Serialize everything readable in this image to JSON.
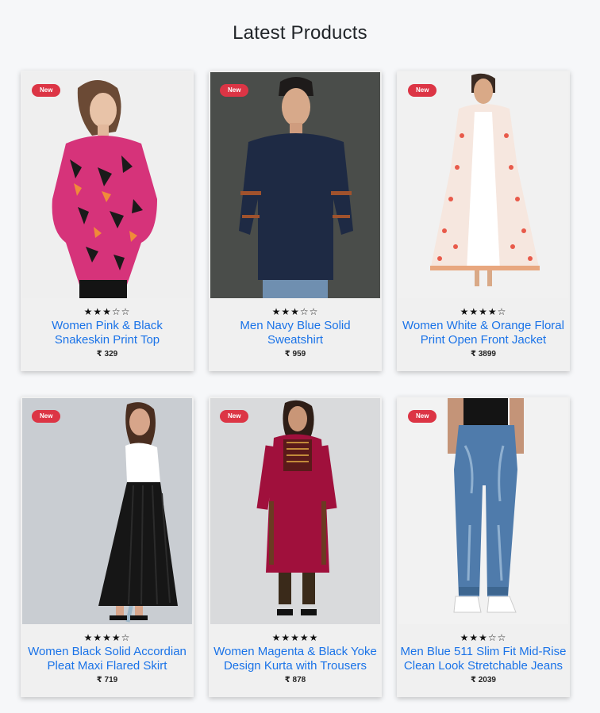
{
  "section": {
    "title": "Latest Products"
  },
  "products": [
    {
      "badge": "New",
      "name": "Women Pink & Black Snakeskin Print Top",
      "rating": 3,
      "rating_max": 5,
      "stars": "★★★☆☆",
      "price": "₹ 329"
    },
    {
      "badge": "New",
      "name": "Men Navy Blue Solid Sweatshirt",
      "rating": 3,
      "rating_max": 5,
      "stars": "★★★☆☆",
      "price": "₹ 959"
    },
    {
      "badge": "New",
      "name": "Women White & Orange Floral Print Open Front Jacket",
      "rating": 4,
      "rating_max": 5,
      "stars": "★★★★☆",
      "price": "₹ 3899"
    },
    {
      "badge": "New",
      "name": "Women Black Solid Accordian Pleat Maxi Flared Skirt",
      "rating": 4,
      "rating_max": 5,
      "stars": "★★★★☆",
      "price": "₹ 719"
    },
    {
      "badge": "New",
      "name": "Women Magenta & Black Yoke Design Kurta with Trousers",
      "rating": 5,
      "rating_max": 5,
      "stars": "★★★★★",
      "price": "₹ 878"
    },
    {
      "badge": "New",
      "name": "Men Blue 511 Slim Fit Mid-Rise Clean Look Stretchable Jeans",
      "rating": 3,
      "rating_max": 5,
      "stars": "★★★☆☆",
      "price": "₹ 2039"
    }
  ],
  "colors": {
    "badge": "#dc3545",
    "link": "#1a73e8",
    "card": "#f0f0f0",
    "page": "#f6f7f9"
  }
}
